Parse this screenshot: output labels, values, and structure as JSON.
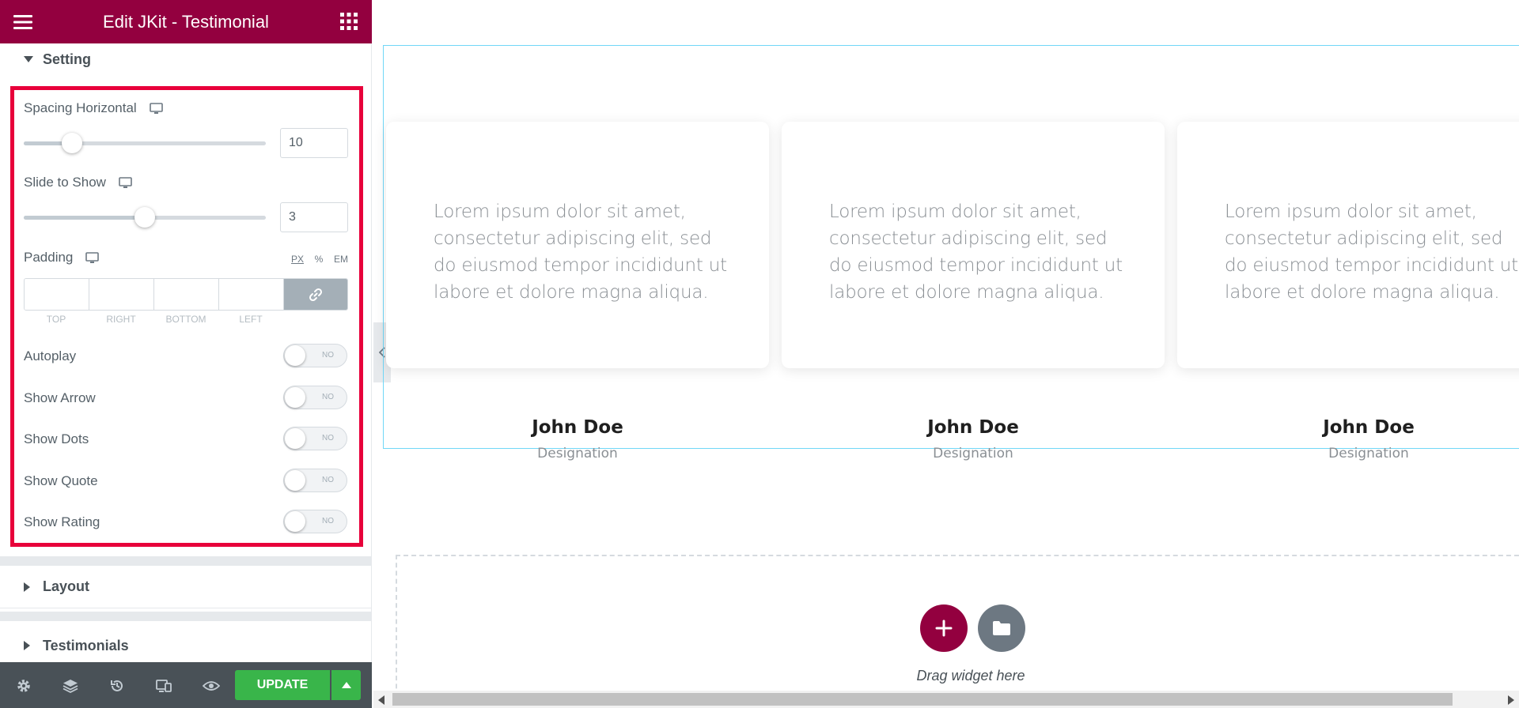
{
  "header": {
    "title": "Edit JKit - Testimonial",
    "menu_icon": "hamburger-icon",
    "grid_icon": "apps-grid-icon"
  },
  "sections": {
    "setting": "Setting",
    "layout": "Layout",
    "testimonials": "Testimonials"
  },
  "controls": {
    "spacing_horizontal": {
      "label": "Spacing Horizontal",
      "value": "10",
      "fraction": 0.2
    },
    "slide_to_show": {
      "label": "Slide to Show",
      "value": "3",
      "fraction": 0.5
    },
    "padding": {
      "label": "Padding",
      "units": [
        "PX",
        "%",
        "EM"
      ],
      "selected_unit": "PX",
      "sides": [
        "TOP",
        "RIGHT",
        "BOTTOM",
        "LEFT"
      ],
      "link_icon": "link-icon"
    },
    "toggles": [
      {
        "label": "Autoplay",
        "state": "NO"
      },
      {
        "label": "Show Arrow",
        "state": "NO"
      },
      {
        "label": "Show Dots",
        "state": "NO"
      },
      {
        "label": "Show Quote",
        "state": "NO"
      },
      {
        "label": "Show Rating",
        "state": "NO"
      }
    ]
  },
  "footer": {
    "update_label": "UPDATE"
  },
  "preview": {
    "testimonials": [
      {
        "text": "Lorem ipsum dolor sit amet, consectetur adipiscing elit, sed do eiusmod tempor incididunt ut labore et dolore magna aliqua.",
        "name": "John Doe",
        "designation": "Designation"
      },
      {
        "text": "Lorem ipsum dolor sit amet, consectetur adipiscing elit, sed do eiusmod tempor incididunt ut labore et dolore magna aliqua.",
        "name": "John Doe",
        "designation": "Designation"
      },
      {
        "text": "Lorem ipsum dolor sit amet, consectetur adipiscing elit, sed do eiusmod tempor incididunt ut labore et dolore magna aliqua.",
        "name": "John Doe",
        "designation": "Designation"
      }
    ],
    "drop_text": "Drag widget here"
  },
  "colors": {
    "brand": "#93003f",
    "highlight": "#e8003a",
    "update": "#39b54a",
    "widget_border": "#71d7f7"
  }
}
